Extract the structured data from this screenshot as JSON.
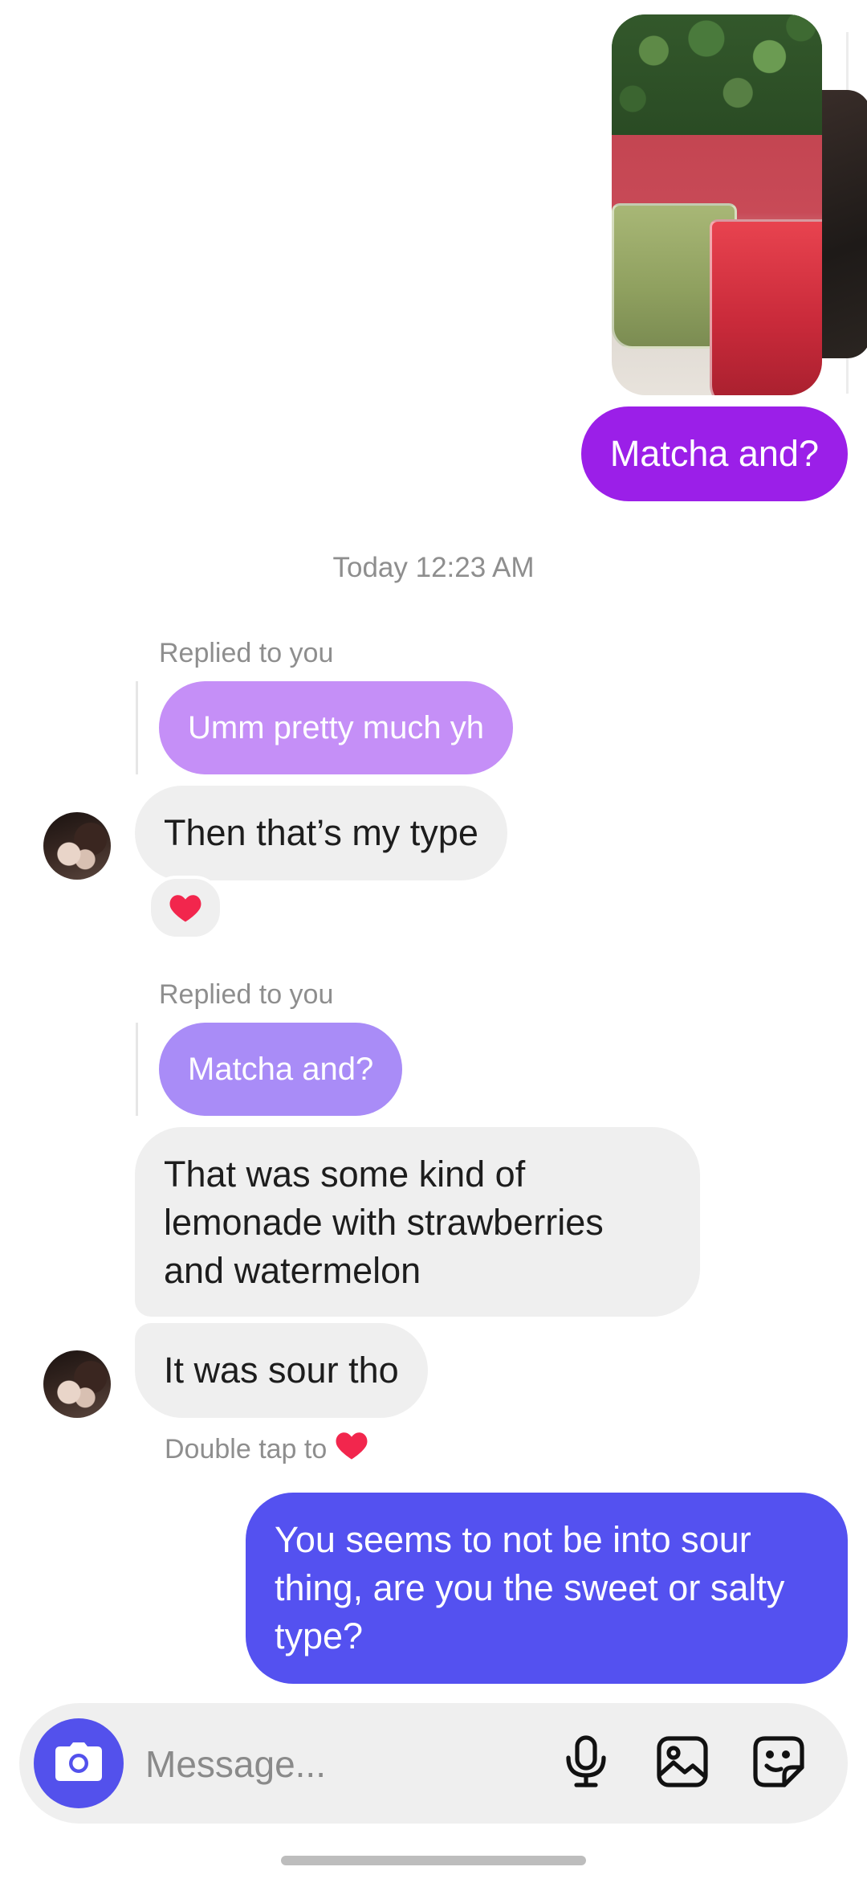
{
  "thread": {
    "outgoing_1": "Matcha and?",
    "timestamp": "Today 12:23 AM",
    "reply_1": {
      "label": "Replied to you",
      "quoted": "Umm pretty much yh",
      "message": "Then that’s my type",
      "reaction": "heart"
    },
    "reply_2": {
      "label": "Replied to you",
      "quoted": "Matcha and?",
      "message": "That was some kind of lemonade with strawberries and watermelon"
    },
    "incoming_3": "It was sour tho",
    "double_tap_hint": "Double tap to",
    "outgoing_2": "You seems to not be into sour thing, are you the sweet or salty type?"
  },
  "composer": {
    "placeholder": "Message...",
    "icons": [
      "camera-icon",
      "microphone-icon",
      "gallery-icon",
      "sticker-icon"
    ]
  },
  "colors": {
    "outgoing_purple": "#9b1fe8",
    "outgoing_blue": "#5451f0",
    "incoming_grey": "#efefef",
    "reply_quote": "#c58ff7",
    "accent_camera": "#5351ec",
    "heart": "#f2264d"
  }
}
